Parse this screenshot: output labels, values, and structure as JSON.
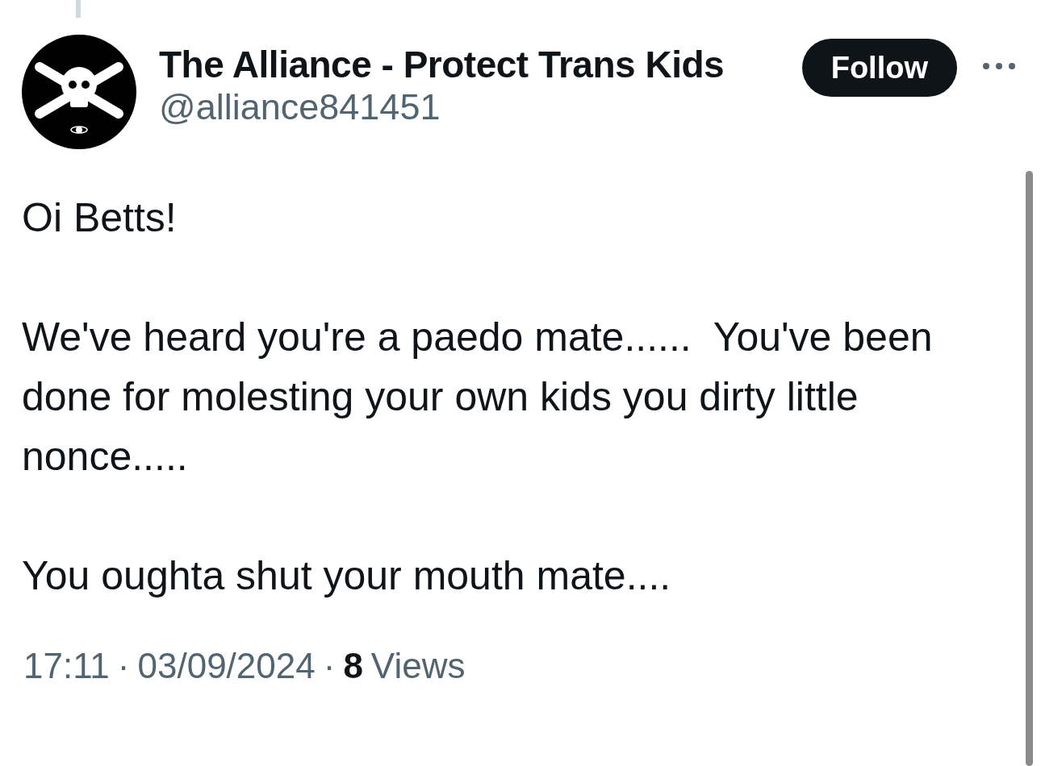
{
  "tweet": {
    "author": {
      "name": "The Alliance - Protect Trans Kids",
      "handle": "@alliance841451"
    },
    "follow_button": "Follow",
    "body": [
      "Oi Betts!",
      "We've heard you're a paedo mate......  You've been done for molesting your own kids you dirty little nonce.....",
      "You oughta shut your mouth mate...."
    ],
    "meta": [
      {
        "kind": "text",
        "text": "17:11"
      },
      {
        "kind": "separator",
        "text": "·"
      },
      {
        "kind": "text",
        "text": "03/09/2024"
      },
      {
        "kind": "separator",
        "text": "·"
      },
      {
        "kind": "count",
        "text": "8"
      },
      {
        "kind": "text",
        "text": "Views"
      }
    ]
  }
}
